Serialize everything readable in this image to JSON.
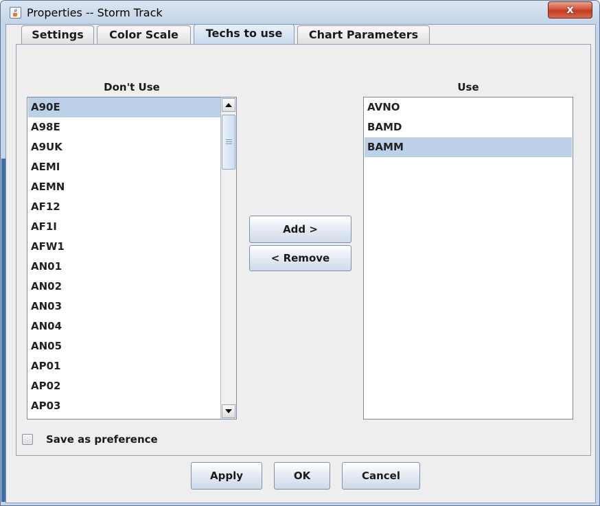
{
  "window": {
    "title": "Properties -- Storm Track",
    "title_icon": "java-cup-icon",
    "close_label": "x"
  },
  "tabs": [
    {
      "label": "Settings",
      "active": false
    },
    {
      "label": "Color Scale",
      "active": false
    },
    {
      "label": "Techs to use",
      "active": true
    },
    {
      "label": "Chart Parameters",
      "active": false
    }
  ],
  "dont_use": {
    "header": "Don't Use",
    "items": [
      "A90E",
      "A98E",
      "A9UK",
      "AEMI",
      "AEMN",
      "AF12",
      "AF1I",
      "AFW1",
      "AN01",
      "AN02",
      "AN03",
      "AN04",
      "AN05",
      "AP01",
      "AP02",
      "AP03"
    ],
    "selected_index": 0
  },
  "use": {
    "header": "Use",
    "items": [
      "AVNO",
      "BAMD",
      "BAMM"
    ],
    "selected_index": 2
  },
  "actions": {
    "add_label": "Add >",
    "remove_label": "< Remove"
  },
  "save_pref": {
    "label": "Save as preference",
    "checked": false
  },
  "footer": {
    "apply_label": "Apply",
    "ok_label": "OK",
    "cancel_label": "Cancel"
  },
  "colors": {
    "selection": "#bcd0e8",
    "close_button": "#c8432b",
    "title_bar": "#c8d8ec"
  }
}
